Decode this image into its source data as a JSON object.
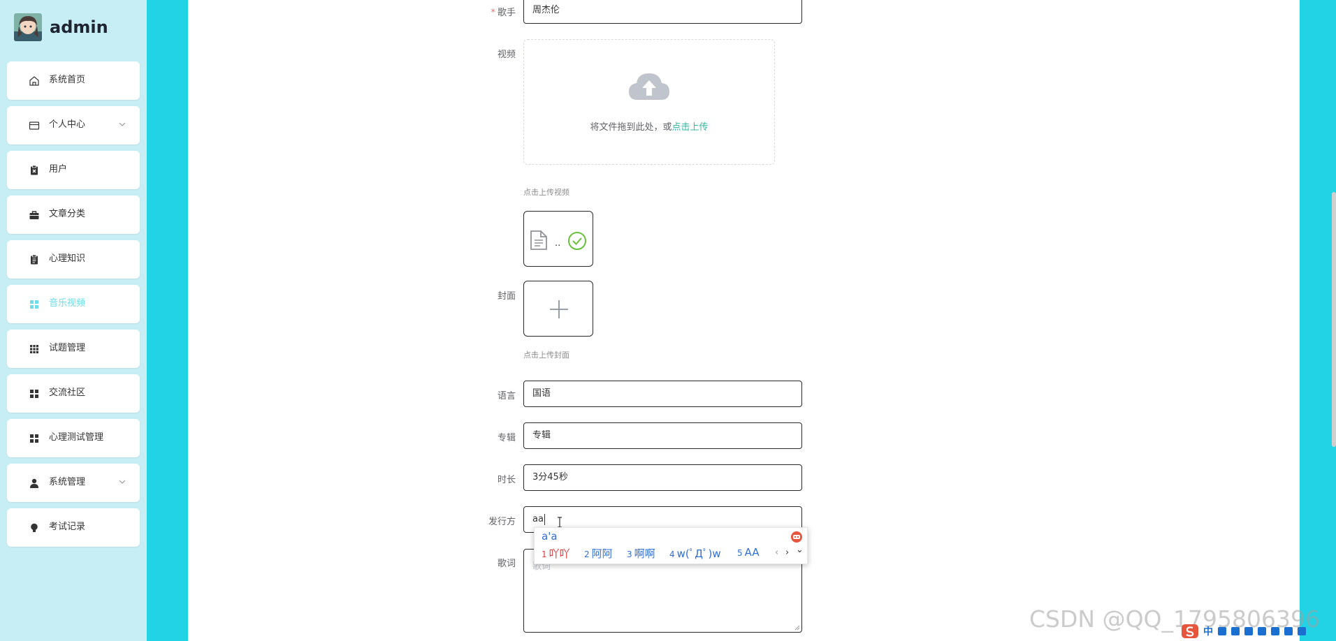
{
  "sidebar": {
    "username": "admin",
    "items": [
      {
        "label": "系统首页",
        "icon": "home-icon"
      },
      {
        "label": "个人中心",
        "icon": "credit-card-icon",
        "has_submenu": true
      },
      {
        "label": "用户",
        "icon": "clipboard-x-icon"
      },
      {
        "label": "文章分类",
        "icon": "briefcase-icon"
      },
      {
        "label": "心理知识",
        "icon": "clipboard-list-icon"
      },
      {
        "label": "音乐视频",
        "icon": "grid-icon",
        "active": true
      },
      {
        "label": "试题管理",
        "icon": "grid-9-icon"
      },
      {
        "label": "交流社区",
        "icon": "grid-icon"
      },
      {
        "label": "心理测试管理",
        "icon": "grid-icon"
      },
      {
        "label": "系统管理",
        "icon": "user-icon",
        "has_submenu": true
      },
      {
        "label": "考试记录",
        "icon": "bulb-icon"
      }
    ],
    "active_color": "#6fdde9"
  },
  "form": {
    "singer": {
      "label": "歌手",
      "value": "周杰伦",
      "required": true
    },
    "video": {
      "label": "视频",
      "drag_text": "将文件拖到此处，或",
      "drag_link": "点击上传",
      "tip": "点击上传视频",
      "file_name": ".."
    },
    "cover": {
      "label": "封面",
      "tip": "点击上传封面"
    },
    "language": {
      "label": "语言",
      "value": "国语"
    },
    "album": {
      "label": "专辑",
      "value": "专辑"
    },
    "duration": {
      "label": "时长",
      "value": "3分45秒"
    },
    "publisher": {
      "label": "发行方",
      "value": "aa"
    },
    "lyrics": {
      "label": "歌词",
      "placeholder": "歌词"
    }
  },
  "ime": {
    "composition": "a'a",
    "candidates": [
      {
        "n": "1",
        "text": "吖吖"
      },
      {
        "n": "2",
        "text": "阿阿"
      },
      {
        "n": "3",
        "text": "啊啊"
      },
      {
        "n": "4",
        "text": "w(ﾟДﾟ)w"
      },
      {
        "n": "5",
        "text": "AA"
      }
    ],
    "prev": "‹",
    "next": "›",
    "more": "⌄"
  },
  "tray": {
    "lang": "中"
  },
  "watermark": "CSDN @QQ_1795806396",
  "colors": {
    "accent": "#22d3e6",
    "sidebar_bg": "#c6eef4",
    "link": "#2fb7a4"
  }
}
